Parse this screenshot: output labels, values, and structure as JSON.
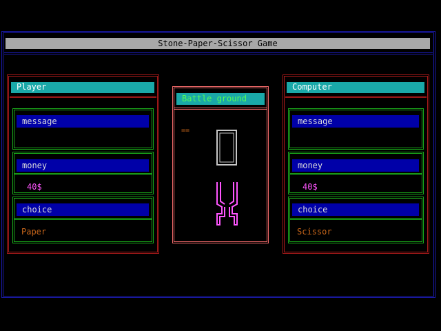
{
  "title": "Stone-Paper-Scissor Game",
  "player": {
    "header": "Player",
    "message_label": "message",
    "message_value": "",
    "money_label": "money",
    "money_value": "40$",
    "choice_label": "choice",
    "choice_value": "Paper"
  },
  "computer": {
    "header": "Computer",
    "message_label": "message",
    "message_value": "",
    "money_label": "money",
    "money_value": "40$",
    "choice_label": "choice",
    "choice_value": "Scissor"
  },
  "battle": {
    "header": "Battle ground",
    "marker": "=="
  },
  "colors": {
    "money": "#ff55ff",
    "choice": "#c8661a",
    "battle_header_text": "#55ff55",
    "paper_sprite": "#c8c8c8",
    "scissor_sprite": "#ff55ff"
  }
}
